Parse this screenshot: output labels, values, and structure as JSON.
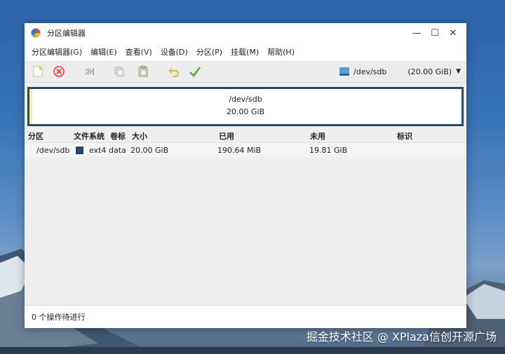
{
  "window": {
    "title": "分区编辑器"
  },
  "window_controls": {
    "minimize": "—",
    "maximize": "☐",
    "close": "✕"
  },
  "menu": [
    "分区编辑器(G)",
    "编辑(E)",
    "查看(V)",
    "设备(D)",
    "分区(P)",
    "挂载(M)",
    "帮助(H)"
  ],
  "device": {
    "name": "/dev/sdb",
    "size": "(20.00 GiB)"
  },
  "disk_visual": {
    "name": "/dev/sdb",
    "size": "20.00 GiB"
  },
  "table": {
    "headers": [
      "分区",
      "文件系统",
      "卷标",
      "大小",
      "已用",
      "未用",
      "标识"
    ],
    "rows": [
      {
        "partition": "/dev/sdb",
        "filesystem": "ext4",
        "label": "data",
        "size": "20.00 GiB",
        "used": "190.64 MiB",
        "unused": "19.81 GiB",
        "flags": ""
      }
    ]
  },
  "status": {
    "text": "0 个操作待进行"
  },
  "watermark": "掘金技术社区 @ XPlaza信创开源广场",
  "colors": {
    "accent": "#2c4862",
    "stripe": "#f4efa9",
    "apply_green": "#5aaa3a",
    "delete_red": "#d94040"
  }
}
